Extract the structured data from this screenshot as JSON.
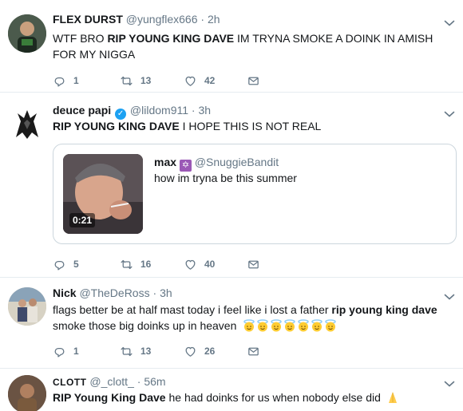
{
  "tweets": [
    {
      "name": "FLEX DURST",
      "handle": "@yungflex666",
      "sep": "·",
      "time": "2h",
      "text_plain_1": "WTF BRO ",
      "text_bold_1": "RIP YOUNG KING DAVE",
      "text_plain_2": " IM TRYNA SMOKE A DOINK IN AMISH FOR MY NIGGA",
      "replies": "1",
      "retweets": "13",
      "likes": "42"
    },
    {
      "name": "deuce papi",
      "handle": "@lildom911",
      "sep": "·",
      "time": "3h",
      "text_bold_1": "RIP YOUNG KING DAVE",
      "text_plain_1": " I HOPE THIS IS NOT REAL",
      "quote": {
        "name": "max",
        "handle": "@SnuggieBandit",
        "text": "how im tryna be this summer",
        "duration": "0:21"
      },
      "replies": "5",
      "retweets": "16",
      "likes": "40"
    },
    {
      "name": "Nick",
      "handle": "@TheDeRoss",
      "sep": "·",
      "time": "3h",
      "text_plain_1": "flags better be at half mast today i feel like i lost a father ",
      "text_bold_1": "rip young king dave",
      "text_plain_2": "smoke those big doinks up in heaven",
      "emoji_count": 7,
      "replies": "1",
      "retweets": "13",
      "likes": "26"
    },
    {
      "name": "CLOTT",
      "handle": "@_clott_",
      "sep": "·",
      "time": "56m",
      "text_bold_1": "RIP Young King Dave",
      "text_plain_1": " he had doinks for us when nobody else did"
    }
  ],
  "icons": {
    "reply": "reply-icon",
    "retweet": "retweet-icon",
    "like": "heart-icon",
    "dm": "envelope-icon",
    "caret": "chevron-down-icon",
    "verified": "verified-badge-icon",
    "star": "star-of-david-icon",
    "halo": "angel-emoji-icon",
    "pray": "praying-hands-emoji-icon"
  },
  "colors": {
    "link_gray": "#657786",
    "verified_blue": "#1da1f2",
    "border": "#e6ecf0",
    "star_purple": "#9b59b6"
  }
}
